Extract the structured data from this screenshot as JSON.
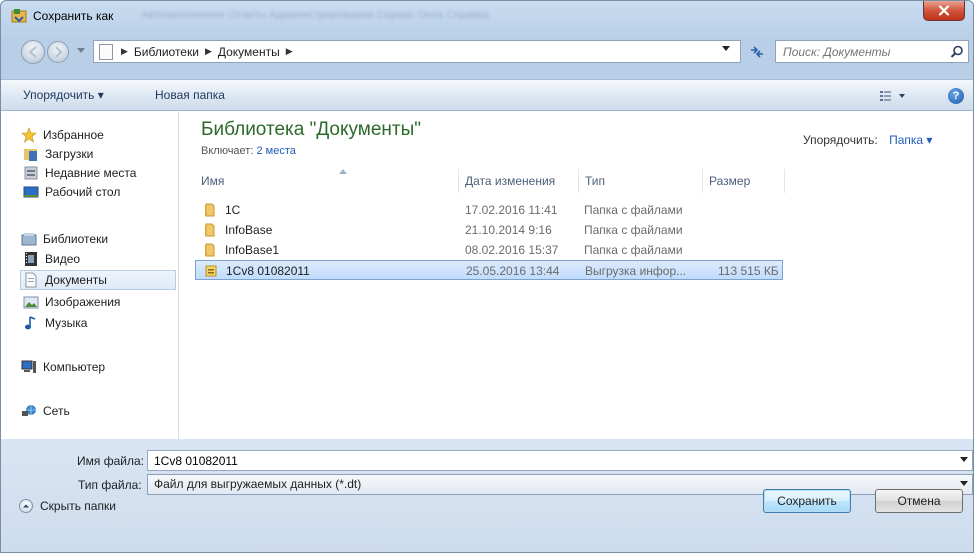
{
  "window": {
    "title": "Сохранить как",
    "background_menu": "Автозаполнение   Отчеты   Администрирование   Сервис   Окна   Справка"
  },
  "address": {
    "crumbs": [
      "Библиотеки",
      "Документы"
    ],
    "search_placeholder": "Поиск: Документы"
  },
  "toolbar": {
    "organize": "Упорядочить ▾",
    "new_folder": "Новая папка"
  },
  "nav": {
    "favorites": "Избранное",
    "downloads": "Загрузки",
    "recent": "Недавние места",
    "desktop": "Рабочий стол",
    "libraries": "Библиотеки",
    "video": "Видео",
    "documents": "Документы",
    "images": "Изображения",
    "music": "Музыка",
    "computer": "Компьютер",
    "network": "Сеть"
  },
  "library": {
    "title": "Библиотека \"Документы\"",
    "includes_label": "Включает:",
    "includes_link": "2 места",
    "arrange_label": "Упорядочить:",
    "arrange_value": "Папка ▾"
  },
  "columns": {
    "name": "Имя",
    "date": "Дата изменения",
    "type": "Тип",
    "size": "Размер"
  },
  "files": [
    {
      "name": "1C",
      "date": "17.02.2016 11:41",
      "type": "Папка с файлами",
      "size": ""
    },
    {
      "name": "InfoBase",
      "date": "21.10.2014 9:16",
      "type": "Папка с файлами",
      "size": ""
    },
    {
      "name": "InfoBase1",
      "date": "08.02.2016 15:37",
      "type": "Папка с файлами",
      "size": ""
    },
    {
      "name": "1Cv8 01082011",
      "date": "25.05.2016 13:44",
      "type": "Выгрузка инфор...",
      "size": "113 515 КБ"
    }
  ],
  "form": {
    "filename_label": "Имя файла:",
    "filename_value": "1Cv8 01082011",
    "filetype_label": "Тип файла:",
    "filetype_value": "Файл для выгружаемых данных (*.dt)",
    "hide_folders": "Скрыть папки",
    "save": "Сохранить",
    "cancel": "Отмена"
  },
  "colors": {
    "accent": "#1f5cb7",
    "library_title": "#2c6a2c",
    "selection": "#c1dcfc",
    "close": "#c0301b"
  }
}
